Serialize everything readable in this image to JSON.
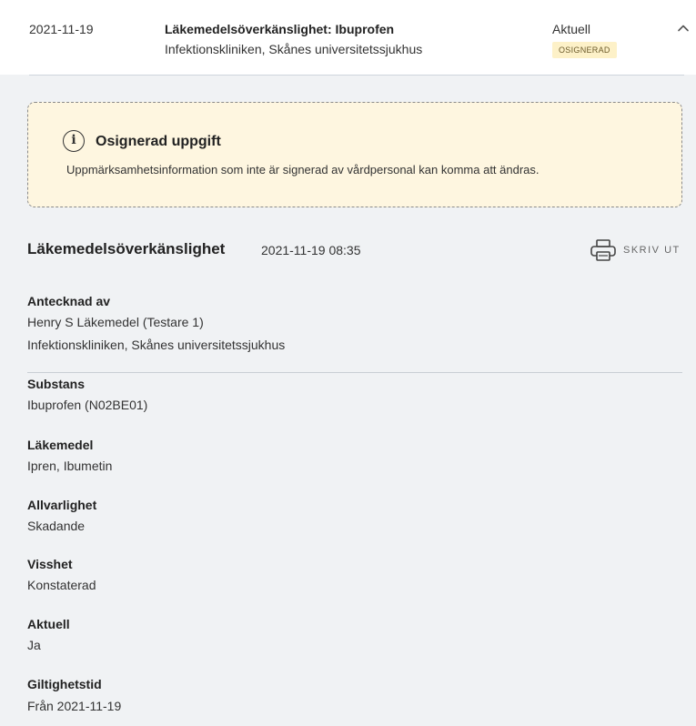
{
  "row": {
    "date": "2021-11-19",
    "title": "Läkemedelsöverkänslighet: Ibuprofen",
    "subtitle": "Infektionskliniken, Skånes universitetssjukhus",
    "status": "Aktuell",
    "badge": "OSIGNERAD"
  },
  "notice": {
    "title": "Osignerad uppgift",
    "text": "Uppmärksamhetsinformation som inte är signerad av vårdpersonal kan komma att ändras.",
    "icon_glyph": "i",
    "icon": "info-icon"
  },
  "section": {
    "title": "Läkemedelsöverkänslighet",
    "datetime": "2021-11-19 08:35",
    "print_label": "SKRIV UT"
  },
  "fields": {
    "noted_by_label": "Antecknad av",
    "noted_by_name": "Henry S Läkemedel (Testare 1)",
    "noted_by_unit": "Infektionskliniken, Skånes universitetssjukhus",
    "substance_label": "Substans",
    "substance_value": "Ibuprofen (N02BE01)",
    "drug_label": "Läkemedel",
    "drug_value": "Ipren, Ibumetin",
    "severity_label": "Allvarlighet",
    "severity_value": "Skadande",
    "certainty_label": "Visshet",
    "certainty_value": "Konstaterad",
    "current_label": "Aktuell",
    "current_value": "Ja",
    "validity_label": "Giltighetstid",
    "validity_value": "Från 2021-11-19"
  },
  "colors": {
    "panel_bg": "#f0f2f4",
    "notice_bg": "#fef6e0",
    "badge_bg": "#fdf1c8"
  }
}
